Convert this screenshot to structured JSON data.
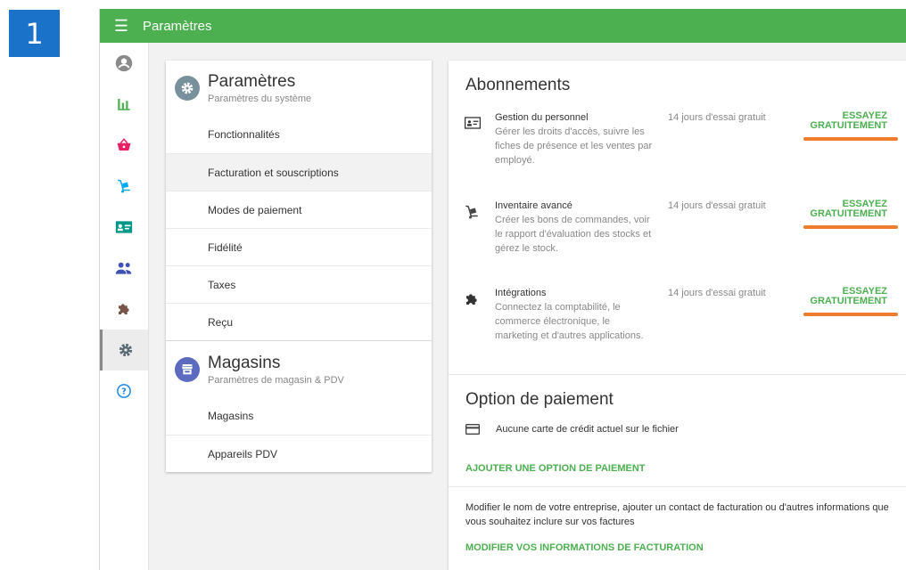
{
  "step_number": "1",
  "topbar": {
    "title": "Paramètres",
    "icon": "menu-icon"
  },
  "sidebar": {
    "items": [
      {
        "name": "account",
        "icon": "account-icon"
      },
      {
        "name": "reports",
        "icon": "chart-icon"
      },
      {
        "name": "items",
        "icon": "basket-icon"
      },
      {
        "name": "inventory",
        "icon": "dolly-icon"
      },
      {
        "name": "employees",
        "icon": "id-card-icon"
      },
      {
        "name": "customers",
        "icon": "people-icon"
      },
      {
        "name": "integrations",
        "icon": "puzzle-icon"
      },
      {
        "name": "settings",
        "icon": "gear-icon",
        "active": true
      },
      {
        "name": "help",
        "icon": "help-icon"
      }
    ]
  },
  "menu": {
    "settings": {
      "title": "Paramètres",
      "subtitle": "Paramètres du système",
      "items": [
        "Fonctionnalités",
        "Facturation et souscriptions",
        "Modes de paiement",
        "Fidélité",
        "Taxes",
        "Reçu"
      ],
      "selected": "Facturation et souscriptions"
    },
    "stores": {
      "title": "Magasins",
      "subtitle": "Paramètres de magasin & PDV",
      "items": [
        "Magasins",
        "Appareils PDV"
      ]
    }
  },
  "subscriptions": {
    "title": "Abonnements",
    "items": [
      {
        "title": "Gestion du personnel",
        "description": "Gérer les droits d'accès, suivre les fiches de présence et les ventes par employé.",
        "trial": "14 jours d'essai gratuit",
        "button_line1": "ESSAYEZ",
        "button_line2": "GRATUITEMENT",
        "icon": "id-card-icon"
      },
      {
        "title": "Inventaire avancé",
        "description": "Créer les bons de commandes, voir le rapport d'évaluation des stocks et gérez le stock.",
        "trial": "14 jours d'essai gratuit",
        "button_line1": "ESSAYEZ",
        "button_line2": "GRATUITEMENT",
        "icon": "dolly-icon"
      },
      {
        "title": "Intégrations",
        "description": "Connectez la comptabilité, le commerce électronique, le marketing et d'autres applications.",
        "trial": "14 jours d'essai gratuit",
        "button_line1": "ESSAYEZ",
        "button_line2": "GRATUITEMENT",
        "icon": "puzzle-icon"
      }
    ]
  },
  "payment": {
    "title": "Option de paiement",
    "no_card": "Aucune carte de crédit actuel sur le fichier",
    "add_link": "AJOUTER UNE OPTION DE PAIEMENT",
    "billing_text": "Modifier le nom de votre entreprise, ajouter un contact de facturation ou d'autres informations que vous souhaitez inclure sur vos factures",
    "billing_link": "MODIFIER VOS INFORMATIONS DE FACTURATION"
  },
  "colors": {
    "green": "#4caf50",
    "orange_highlight": "#f07c2e",
    "badge_blue": "#1a73c8"
  }
}
